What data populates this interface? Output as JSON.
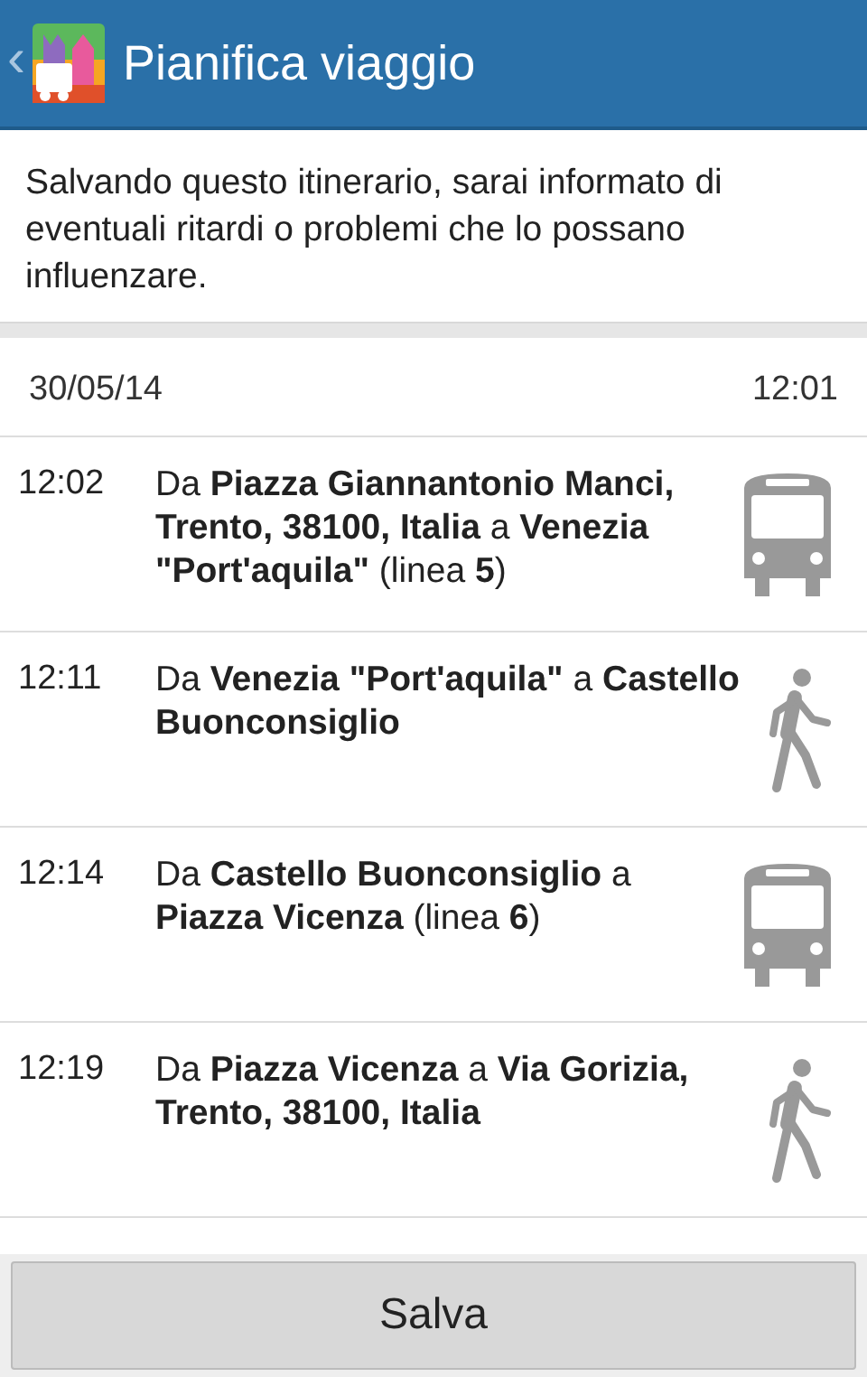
{
  "header": {
    "back": "‹",
    "title": "Pianifica viaggio"
  },
  "notice": "Salvando questo itinerario, sarai informato di eventuali ritardi o problemi che lo possano influenzare.",
  "trip": {
    "date": "30/05/14",
    "time": "12:01"
  },
  "steps": [
    {
      "time": "12:02",
      "kind": "bus",
      "text": "Da **Piazza Giannantonio Manci, Trento, 38100, Italia** a **Venezia \"Port'aquila\"** (linea **5**)"
    },
    {
      "time": "12:11",
      "kind": "walk",
      "text": "Da **Venezia \"Port'aquila\"** a **Castello Buonconsiglio**"
    },
    {
      "time": "12:14",
      "kind": "bus",
      "text": "Da **Castello Buonconsiglio** a **Piazza Vicenza** (linea **6**)"
    },
    {
      "time": "12:19",
      "kind": "walk",
      "text": "Da **Piazza Vicenza** a **Via Gorizia, Trento, 38100, Italia**"
    }
  ],
  "save_button": "Salva"
}
